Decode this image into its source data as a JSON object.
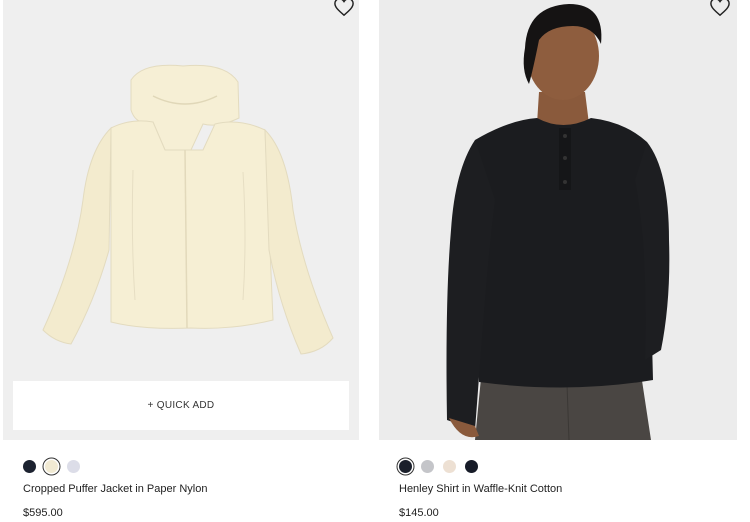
{
  "products": [
    {
      "name": "Cropped Puffer Jacket in Paper Nylon",
      "price": "$595.00",
      "quick_add_label": "+ QUICK ADD",
      "image_subject": "cream cropped puffer jacket with hood",
      "swatches": [
        {
          "color": "#1c2230",
          "selected": false
        },
        {
          "color": "#f1ead3",
          "selected": true
        },
        {
          "color": "#dcdde8",
          "selected": false
        }
      ]
    },
    {
      "name": "Henley Shirt in Waffle-Knit Cotton",
      "price": "$145.00",
      "image_subject": "model wearing black henley shirt and grey trousers",
      "swatches": [
        {
          "color": "#1a1f2b",
          "selected": true
        },
        {
          "color": "#c4c5c9",
          "selected": false
        },
        {
          "color": "#ede0d3",
          "selected": false
        },
        {
          "color": "#161b28",
          "selected": false
        }
      ]
    }
  ],
  "icons": {
    "wishlist": "heart-outline-icon"
  }
}
